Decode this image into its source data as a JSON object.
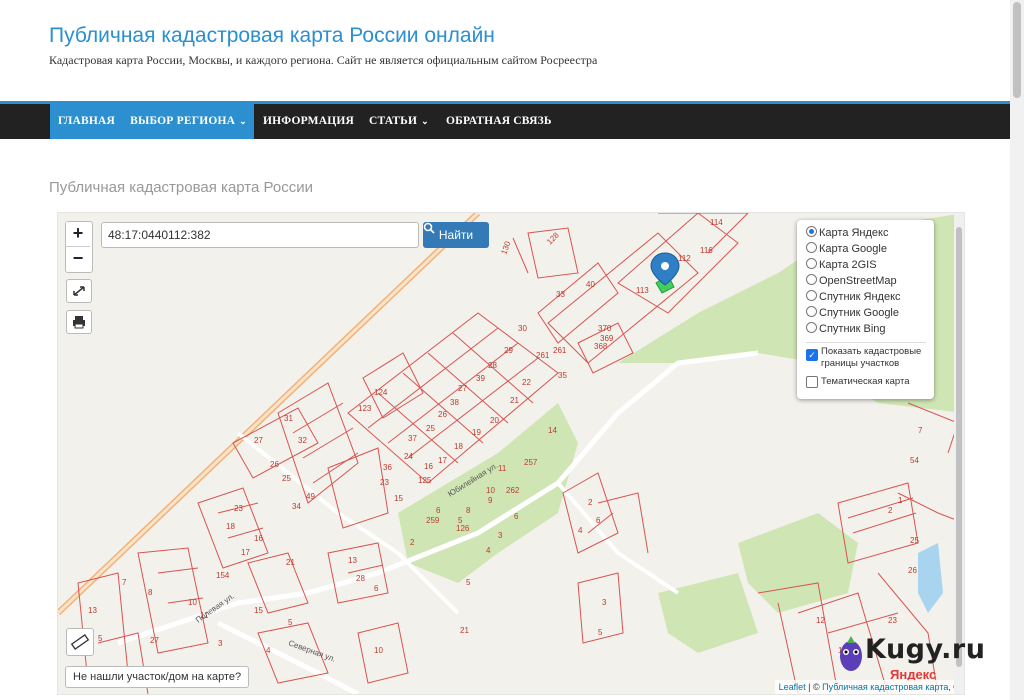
{
  "header": {
    "title": "Публичная кадастровая карта России онлайн",
    "description": "Кадастровая карта России, Москвы, и каждого региона. Сайт не является официальным сайтом Росреестра"
  },
  "nav": {
    "items": [
      {
        "label": "ГЛАВНАЯ"
      },
      {
        "label": "ВЫБОР РЕГИОНА"
      },
      {
        "label": "ИНФОРМАЦИЯ"
      },
      {
        "label": "СТАТЬИ"
      },
      {
        "label": "ОБРАТНАЯ СВЯЗЬ"
      }
    ]
  },
  "page": {
    "heading": "Публичная кадастровая карта России"
  },
  "map": {
    "zoom_in": "+",
    "zoom_out": "−",
    "search_value": "48:17:0440112:382",
    "search_button": "Найти",
    "layers": [
      {
        "label": "Карта Яндекс",
        "selected": true
      },
      {
        "label": "Карта Google",
        "selected": false
      },
      {
        "label": "Карта 2GIS",
        "selected": false
      },
      {
        "label": "OpenStreetMap",
        "selected": false
      },
      {
        "label": "Спутник Яндекс",
        "selected": false
      },
      {
        "label": "Спутник Google",
        "selected": false
      },
      {
        "label": "Спутник Bing",
        "selected": false
      }
    ],
    "overlay_cadastre": {
      "label_line1": "Показать кадастровые",
      "label_line2": "границы участков",
      "checked": true
    },
    "overlay_thematic": {
      "label": "Тематическая карта",
      "checked": false
    },
    "not_found_button": "Не нашли участок/дом на карте?",
    "attribution_leaflet": "Leaflet",
    "attribution_sep": " | © ",
    "attribution_site": "Публичная кадастровая карта",
    "attribution_tail": ", ©",
    "yandex_watermark": "Яндекс",
    "street_yubileynaya": "Юбилейная ул.",
    "street_severnaya": "Северная ул.",
    "street_polevaya": "Полевая ул."
  },
  "watermark": {
    "text": "Kugy.ru"
  },
  "colors": {
    "accent": "#2b8fd0",
    "nav_bg": "#222222",
    "parcel_stroke": "#d9534f",
    "green": "#cfe6b4"
  }
}
